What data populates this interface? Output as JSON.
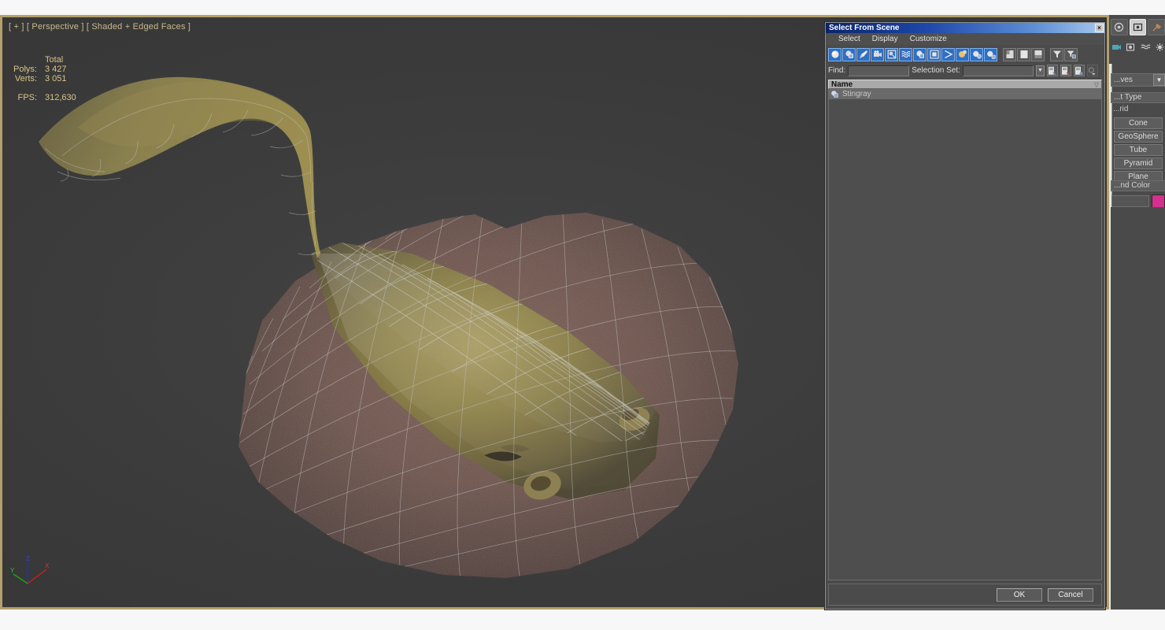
{
  "viewport": {
    "label": "[ + ] [ Perspective ] [ Shaded + Edged Faces ]",
    "stats": {
      "header": "Total",
      "polys_label": "Polys:",
      "polys_value": "3 427",
      "verts_label": "Verts:",
      "verts_value": "3 051",
      "fps_label": "FPS:",
      "fps_value": "312,630"
    },
    "axis": {
      "x": "X",
      "y": "Y",
      "z": "Z"
    },
    "colors": {
      "background": "#3c3c3c",
      "border": "#b3a06a",
      "text": "#d8c488",
      "axis_x": "#d02020",
      "axis_y": "#1ea01e",
      "axis_z": "#2030d0"
    }
  },
  "dialog": {
    "title": "Select From Scene",
    "close_label": "×",
    "menus": [
      "Select",
      "Display",
      "Customize"
    ],
    "toolbar": [
      {
        "name": "display-geometry",
        "glyph": "●",
        "active": true
      },
      {
        "name": "display-shapes",
        "glyph": "◑",
        "active": true
      },
      {
        "name": "display-lights",
        "glyph": "◢",
        "active": true
      },
      {
        "name": "display-cameras",
        "glyph": "▣",
        "active": true
      },
      {
        "name": "display-helpers",
        "glyph": "⊞",
        "active": true
      },
      {
        "name": "display-space-warps",
        "glyph": "≈",
        "active": true
      },
      {
        "name": "display-groups",
        "glyph": "◔",
        "active": true
      },
      {
        "name": "display-xrefs",
        "glyph": "□",
        "active": true
      },
      {
        "name": "display-bones",
        "glyph": "≻",
        "active": true
      },
      {
        "name": "display-children",
        "glyph": "◕",
        "active": true
      },
      {
        "name": "display-influences",
        "glyph": "⚙",
        "active": true
      },
      {
        "name": "display-frozen",
        "glyph": "❄",
        "active": true
      },
      {
        "name": "expand-all",
        "glyph": "▤",
        "active": false
      },
      {
        "name": "collapse-all",
        "glyph": "□",
        "active": false
      },
      {
        "name": "expand-selected",
        "glyph": "▥",
        "active": false
      },
      {
        "name": "filter-toggle",
        "glyph": "▽",
        "active": false
      },
      {
        "name": "filter-settings",
        "glyph": "▼",
        "active": false
      }
    ],
    "find": {
      "label": "Find:",
      "value": "",
      "placeholder": ""
    },
    "selection_set": {
      "label": "Selection Set:",
      "value": "",
      "placeholder": ""
    },
    "selset_buttons": [
      {
        "name": "add-selection-set",
        "glyph": "☰"
      },
      {
        "name": "remove-selection-set",
        "glyph": "☰"
      },
      {
        "name": "edit-selection-set",
        "glyph": "☰"
      }
    ],
    "list": {
      "column_header": "Name",
      "sort_glyph": "▽",
      "rows": [
        {
          "name": "Stingray",
          "icon": "object-icon",
          "selected": true
        }
      ]
    },
    "footer": {
      "ok": "OK",
      "cancel": "Cancel"
    },
    "colors": {
      "titlebar_start": "#0a246a",
      "titlebar_end": "#a6c8ee",
      "panel_bg": "#4b4b4b",
      "toolbar_active": "#2f6fc4",
      "list_header_bg": "#a9a9a9",
      "row_selected_bg": "#6a6a6a"
    }
  },
  "command_panel": {
    "tabs": [
      {
        "name": "create-tab",
        "glyph": "◎",
        "selected": false
      },
      {
        "name": "modify-tab",
        "glyph": "▣",
        "selected": true
      },
      {
        "name": "hierarchy-tab",
        "glyph": "⚒",
        "selected": false
      }
    ],
    "sub_icons": [
      {
        "name": "camera-icon",
        "glyph": "🎥"
      },
      {
        "name": "light-icon",
        "glyph": "▣"
      },
      {
        "name": "spacewarp-icon",
        "glyph": "≈"
      },
      {
        "name": "systems-icon",
        "glyph": "✹"
      }
    ],
    "category_dropdown": {
      "value": "...ves",
      "arrow": "▼"
    },
    "object_type_rollout": {
      "title": "...t Type",
      "autogrid_label": "...rid"
    },
    "primitive_buttons": [
      "Cone",
      "GeoSphere",
      "Tube",
      "Pyramid",
      "Plane"
    ],
    "name_color_rollout": {
      "title": "...nd Color",
      "swatch": "#d6308f",
      "name_value": ""
    }
  }
}
